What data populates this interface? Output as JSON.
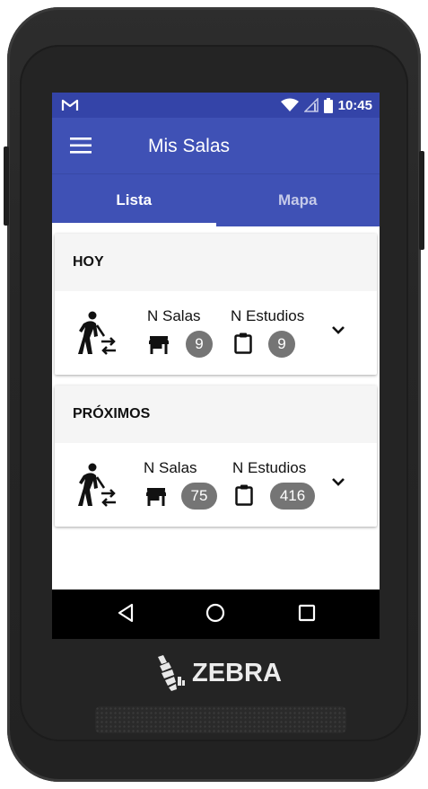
{
  "statusbar": {
    "time": "10:45",
    "notification_icon": "gmail-icon"
  },
  "appbar": {
    "title": "Mis Salas"
  },
  "tabs": [
    {
      "label": "Lista",
      "active": true
    },
    {
      "label": "Mapa",
      "active": false
    }
  ],
  "sections": [
    {
      "title": "HOY",
      "salas_label": "N Salas",
      "salas_count": "9",
      "estudios_label": "N Estudios",
      "estudios_count": "9"
    },
    {
      "title": "PRÓXIMOS",
      "salas_label": "N Salas",
      "salas_count": "75",
      "estudios_label": "N Estudios",
      "estudios_count": "416"
    }
  ],
  "device": {
    "brand": "ZEBRA"
  },
  "colors": {
    "primary": "#3f51b5",
    "status_bar": "#3444a8",
    "chip": "#757575"
  }
}
